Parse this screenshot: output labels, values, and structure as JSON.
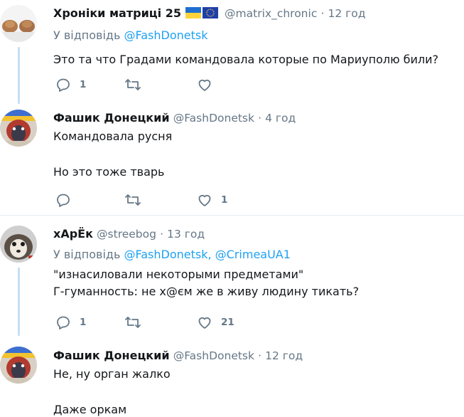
{
  "tweets": [
    {
      "name": "Хроніки матриці 25",
      "flags": [
        "ukraine-flag",
        "eu-flag"
      ],
      "handle": "@matrix_chronic",
      "dot": "·",
      "time": "12 год",
      "reply_prefix": "У відповідь",
      "reply_to": [
        "@FashDonetsk"
      ],
      "lines": [
        "Это та что Градами командовала которые по Мариуполю били?"
      ],
      "reply_count": "1",
      "retweet_count": "",
      "like_count": ""
    },
    {
      "name": "Фашик Донецкий",
      "handle": "@FashDonetsk",
      "dot": "·",
      "time": "4 год",
      "lines": [
        "Командовала русня",
        "",
        "Но это тоже тварь"
      ],
      "reply_count": "",
      "retweet_count": "",
      "like_count": "1"
    },
    {
      "name": "хАрЁк",
      "handle": "@streebog",
      "dot": "·",
      "time": "13 год",
      "reply_prefix": "У відповідь",
      "reply_to": [
        "@FashDonetsk",
        "@CrimeaUA1"
      ],
      "reply_sep": ",",
      "lines": [
        "\"изнасиловали некоторыми предметами\"",
        "Г-гуманность: не х@єм же в живу людину тикать?"
      ],
      "reply_count": "1",
      "retweet_count": "",
      "like_count": "21"
    },
    {
      "name": "Фашик Донецкий",
      "handle": "@FashDonetsk",
      "dot": "·",
      "time": "12 год",
      "lines": [
        "Не, ну орган жалко",
        "",
        "Даже оркам"
      ]
    }
  ],
  "colors": {
    "link": "#1da1f2",
    "muted": "#657786",
    "text": "#14171a",
    "thread_line": "#c4e0f5",
    "divider": "#e6ecf0"
  },
  "icons": [
    "reply-icon",
    "retweet-icon",
    "like-icon"
  ]
}
